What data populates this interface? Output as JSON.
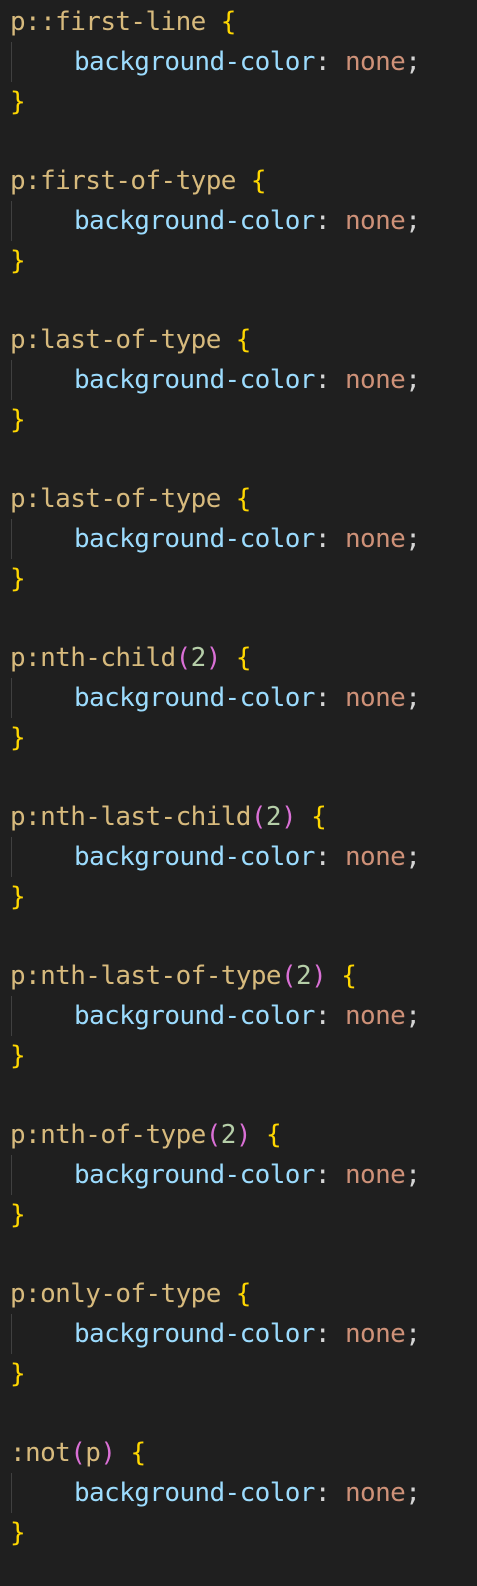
{
  "editor": {
    "rules": [
      {
        "selector": "p::first-line",
        "arg": "",
        "tail": "",
        "open_paren": "",
        "close_paren": ""
      },
      {
        "selector": "p:first-of-type",
        "arg": "",
        "tail": "",
        "open_paren": "",
        "close_paren": ""
      },
      {
        "selector": "p:last-of-type",
        "arg": "",
        "tail": "",
        "open_paren": "",
        "close_paren": ""
      },
      {
        "selector": "p:last-of-type",
        "arg": "",
        "tail": "",
        "open_paren": "",
        "close_paren": ""
      },
      {
        "selector": "p:nth-child",
        "open_paren": "(",
        "arg": "2",
        "close_paren": ")",
        "tail": ""
      },
      {
        "selector": "p:nth-last-child",
        "open_paren": "(",
        "arg": "2",
        "close_paren": ")",
        "tail": ""
      },
      {
        "selector": "p:nth-last-of-type",
        "open_paren": "(",
        "arg": "2",
        "close_paren": ")",
        "tail": ""
      },
      {
        "selector": "p:nth-of-type",
        "open_paren": "(",
        "arg": "2",
        "close_paren": ")",
        "tail": ""
      },
      {
        "selector": "p:only-of-type",
        "arg": "",
        "tail": "",
        "open_paren": "",
        "close_paren": ""
      },
      {
        "selector": ":not",
        "open_paren": "(",
        "arg": "p",
        "close_paren": ")",
        "tail": ""
      }
    ],
    "open_brace": " {",
    "close_brace": "}",
    "property": "background-color",
    "colon": ":",
    "value": "none",
    "semicolon": ";",
    "colors": {
      "background": "#1f1f1f",
      "selector": "#d7ba7d",
      "brace": "#ffd700",
      "paren": "#da70d6",
      "number": "#b5cea8",
      "property": "#9cdcfe",
      "value": "#ce9178"
    }
  }
}
